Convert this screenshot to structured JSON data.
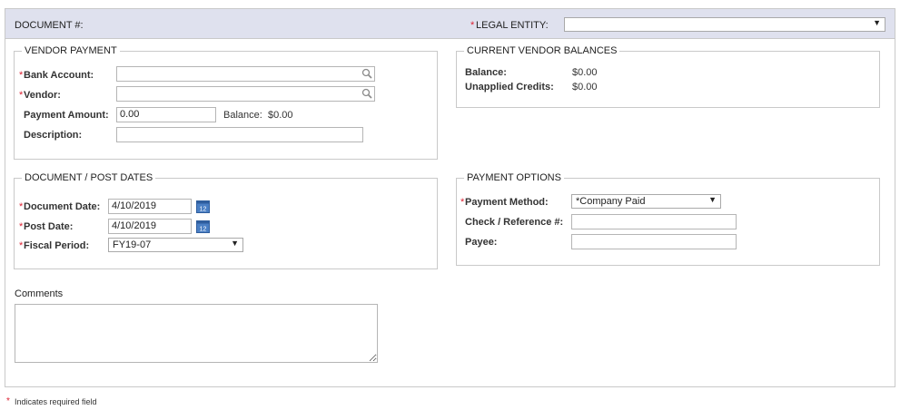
{
  "header": {
    "document_label": "DOCUMENT #:",
    "legal_entity_label": "LEGAL ENTITY:",
    "legal_entity_value": ""
  },
  "vendor_payment": {
    "title": "VENDOR PAYMENT",
    "bank_account_label": "Bank Account:",
    "bank_account_value": "",
    "vendor_label": "Vendor:",
    "vendor_value": "",
    "payment_amount_label": "Payment Amount:",
    "payment_amount_value": "0.00",
    "balance_label": "Balance:",
    "balance_value": "$0.00",
    "description_label": "Description:",
    "description_value": ""
  },
  "current_balances": {
    "title": "CURRENT VENDOR BALANCES",
    "balance_label": "Balance:",
    "balance_value": "$0.00",
    "unapplied_label": "Unapplied Credits:",
    "unapplied_value": "$0.00"
  },
  "dates": {
    "title": "DOCUMENT / POST DATES",
    "document_date_label": "Document Date:",
    "document_date_value": "4/10/2019",
    "post_date_label": "Post Date:",
    "post_date_value": "4/10/2019",
    "fiscal_period_label": "Fiscal Period:",
    "fiscal_period_value": "FY19-07"
  },
  "payment_options": {
    "title": "PAYMENT OPTIONS",
    "method_label": "Payment Method:",
    "method_value": "*Company Paid",
    "check_label": "Check / Reference #:",
    "check_value": "",
    "payee_label": "Payee:",
    "payee_value": ""
  },
  "comments": {
    "label": "Comments",
    "value": ""
  },
  "footer": {
    "required_star": "*",
    "required_note": "Indicates required field"
  },
  "required_marker": "*",
  "calendar_icon_text": "12",
  "colors": {
    "header_bg": "#dfe1ee",
    "required": "#dd2233",
    "calendar": "#4a7fc4"
  }
}
